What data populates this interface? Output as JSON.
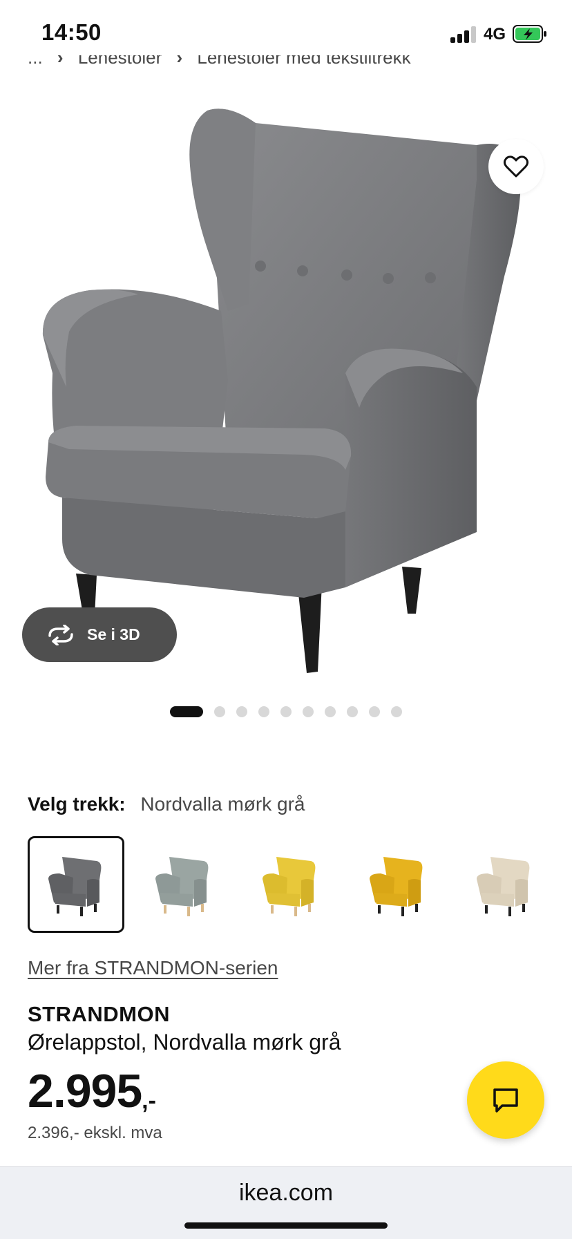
{
  "status_bar": {
    "time": "14:50",
    "network": "4G",
    "battery_color": "#34c759"
  },
  "breadcrumb": {
    "ellipsis": "...",
    "items": [
      "Lenestoler",
      "Lenestoler med tekstiltrekk"
    ]
  },
  "gallery": {
    "see_3d_label": "Se i 3D",
    "dot_count": 10,
    "active_index": 0,
    "icons": [
      "heart-icon",
      "rotate-3d-icon"
    ]
  },
  "cover": {
    "label": "Velg trekk:",
    "selected": "Nordvalla mørk grå",
    "swatch_colors": [
      "#6e6f72",
      "#9aa5a2",
      "#e8c83a",
      "#e6b31e",
      "#dfd3bd"
    ]
  },
  "series_link": "Mer fra STRANDMON-serien",
  "product": {
    "name": "STRANDMON",
    "description": "Ørelappstol, Nordvalla mørk grå",
    "price": "2.995",
    "price_suffix": ",-",
    "price_ex_vat": "2.396,- ekskl. mva"
  },
  "chat": {
    "icon": "chat-bubble-icon",
    "color": "#ffda1a"
  },
  "browser": {
    "url": "ikea.com"
  }
}
